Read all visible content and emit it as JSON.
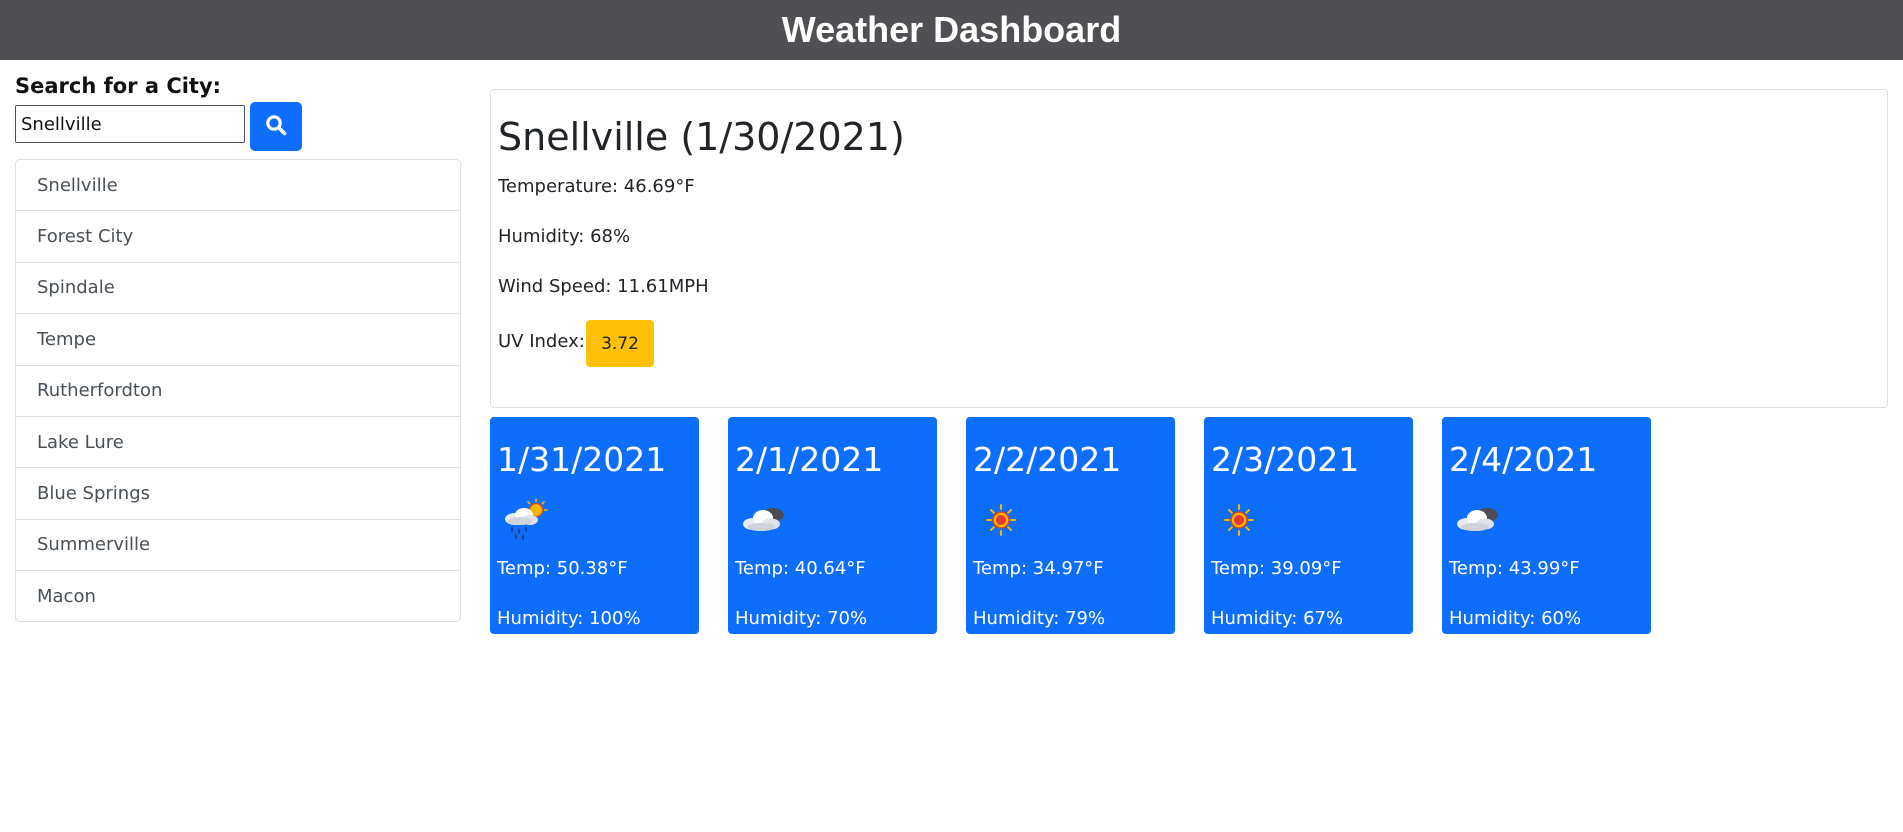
{
  "header": {
    "title": "Weather Dashboard"
  },
  "search": {
    "label": "Search for a City:",
    "input_value": "Snellville",
    "button_icon": "search-icon"
  },
  "history": [
    {
      "label": "Snellville"
    },
    {
      "label": "Forest City"
    },
    {
      "label": "Spindale"
    },
    {
      "label": "Tempe"
    },
    {
      "label": "Rutherfordton"
    },
    {
      "label": "Lake Lure"
    },
    {
      "label": "Blue Springs"
    },
    {
      "label": "Summerville"
    },
    {
      "label": "Macon"
    }
  ],
  "current": {
    "title": "Snellville (1/30/2021)",
    "temperature": "Temperature: 46.69°F",
    "humidity": "Humidity: 68%",
    "wind": "Wind Speed: 11.61MPH",
    "uv_label": "UV Index:",
    "uv_value": "3.72",
    "uv_color": "#ffc107"
  },
  "forecast": [
    {
      "date": "1/31/2021",
      "icon": "rain-sun-icon",
      "temp": "Temp: 50.38°F",
      "humidity": "Humidity: 100%"
    },
    {
      "date": "2/1/2021",
      "icon": "cloud-icon",
      "temp": "Temp: 40.64°F",
      "humidity": "Humidity: 70%"
    },
    {
      "date": "2/2/2021",
      "icon": "sun-icon",
      "temp": "Temp: 34.97°F",
      "humidity": "Humidity: 79%"
    },
    {
      "date": "2/3/2021",
      "icon": "sun-icon",
      "temp": "Temp: 39.09°F",
      "humidity": "Humidity: 67%"
    },
    {
      "date": "2/4/2021",
      "icon": "cloud-icon",
      "temp": "Temp: 43.99°F",
      "humidity": "Humidity: 60%"
    }
  ],
  "colors": {
    "header_bg": "#4f4f54",
    "accent": "#0d6efd",
    "uv_moderate": "#ffc107"
  }
}
